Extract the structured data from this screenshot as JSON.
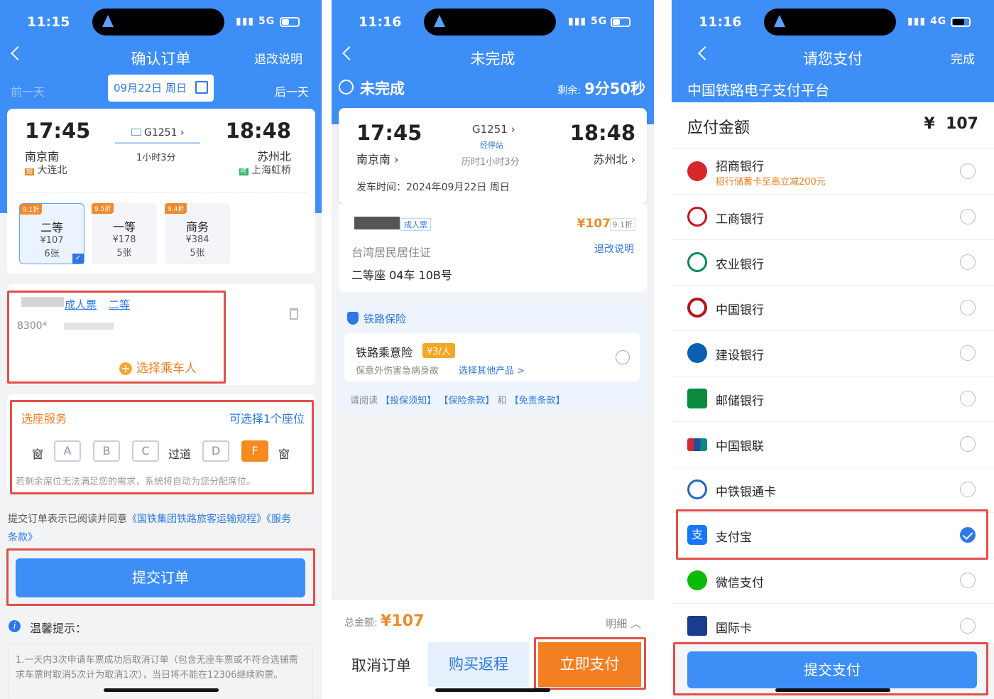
{
  "colors": {
    "primary": "#3e8ef7",
    "orange": "#f27f22",
    "red_box": "#e0504b",
    "price": "#f08a2c"
  },
  "s1": {
    "status": {
      "time": "11:15",
      "net": "5G"
    },
    "nav": {
      "title": "确认订单",
      "right": "退改说明"
    },
    "date": {
      "prev": "前一天",
      "current": "09月22日 周日",
      "next": "后一天"
    },
    "trip": {
      "dep_time": "17:45",
      "arr_time": "18:48",
      "train": "G1251",
      "duration": "1小时3分",
      "dep_station": "南京南",
      "arr_station": "苏州北",
      "origin_tag": "始",
      "origin": "大连北",
      "term_tag": "终",
      "terminus": "上海虹桥"
    },
    "seats": [
      {
        "disc": "9.1折",
        "name": "二等",
        "price": "¥107",
        "count": "6张"
      },
      {
        "disc": "9.5折",
        "name": "一等",
        "price": "¥178",
        "count": "5张"
      },
      {
        "disc": "9.4折",
        "name": "商务",
        "price": "¥384",
        "count": "5张"
      }
    ],
    "passenger": {
      "ticket": "成人票",
      "class": "二等",
      "id": "8300*",
      "select": "选择乘车人"
    },
    "seatsel": {
      "title": "选座服务",
      "hint": "可选择1个座位",
      "window": "窗",
      "aisle": "过道",
      "letters": [
        "A",
        "B",
        "C",
        "D",
        "F"
      ],
      "note": "若剩余席位无法满足您的需求，系统将自动为您分配席位。"
    },
    "agree": {
      "prefix": "提交订单表示已阅读并同意",
      "link1": "《国铁集团铁路旅客运输规程》《服务",
      "link2": "条款》"
    },
    "submit": "提交订单",
    "tips": {
      "title": "温馨提示：",
      "body": "1.一天内3次申请车票成功后取消订单（包含无座车票或不符合选铺需求车票时取消5次计为取消1次），当日将不能在12306继续购票。"
    }
  },
  "s2": {
    "status": {
      "time": "11:16",
      "net": "5G"
    },
    "nav": {
      "title": "未完成"
    },
    "state": {
      "label": "未完成",
      "remain_label": "剩余:",
      "remain": "9分50秒"
    },
    "trip": {
      "dep_time": "17:45",
      "arr_time": "18:48",
      "train": "G1251",
      "stops": "经停站",
      "duration": "历时1小时3分",
      "dep_station": "南京南",
      "arr_station": "苏州北",
      "departure": "发车时间：2024年09月22日 周日"
    },
    "ticket": {
      "type": "成人票",
      "price": "¥107",
      "disc": "9.1折",
      "id_type": "台湾居民居住证",
      "refund": "退改说明",
      "seat": "二等座 04车 10B号"
    },
    "insurance": {
      "title": "铁路保险",
      "name": "铁路乘意险",
      "price": "¥3/人",
      "desc": "保意外伤害急病身故",
      "other": "选择其他产品 >",
      "read": "请阅读",
      "notice": "【投保须知】",
      "terms": "【保险条款】",
      "and": "和",
      "exempt": "【免责条款】"
    },
    "bottom": {
      "total_label": "总金额:",
      "total": "¥107",
      "detail": "明细",
      "cancel": "取消订单",
      "return": "购买返程",
      "pay": "立即支付"
    }
  },
  "s3": {
    "status": {
      "time": "11:16",
      "net": "4G"
    },
    "nav": {
      "title": "请您支付",
      "right": "完成"
    },
    "platform": "中国铁路电子支付平台",
    "amount": {
      "label": "应付金额",
      "currency": "¥",
      "value": "107"
    },
    "banks": [
      {
        "name": "招商银行",
        "promo": "招行储蓄卡至高立减200元",
        "icon": "cmb-icon",
        "color": "#d7262c"
      },
      {
        "name": "工商银行",
        "icon": "icbc-icon",
        "color": "#c8161d"
      },
      {
        "name": "农业银行",
        "icon": "abc-icon",
        "color": "#0d8a5a"
      },
      {
        "name": "中国银行",
        "icon": "boc-icon",
        "color": "#b5121b"
      },
      {
        "name": "建设银行",
        "icon": "ccb-icon",
        "color": "#0b5fb3"
      },
      {
        "name": "邮储银行",
        "icon": "psbc-icon",
        "color": "#0a8a3d"
      },
      {
        "name": "中国银联",
        "icon": "unionpay-icon",
        "color": "#d6262f"
      },
      {
        "name": "中铁银通卡",
        "icon": "crcard-icon",
        "color": "#2567c2"
      },
      {
        "name": "支付宝",
        "icon": "alipay-icon",
        "color": "#1677ff",
        "selected": true
      },
      {
        "name": "微信支付",
        "icon": "wechat-icon",
        "color": "#09bb07"
      },
      {
        "name": "国际卡",
        "icon": "intl-card-icon",
        "color": "#1a3c8f"
      }
    ],
    "submit": "提交支付"
  }
}
